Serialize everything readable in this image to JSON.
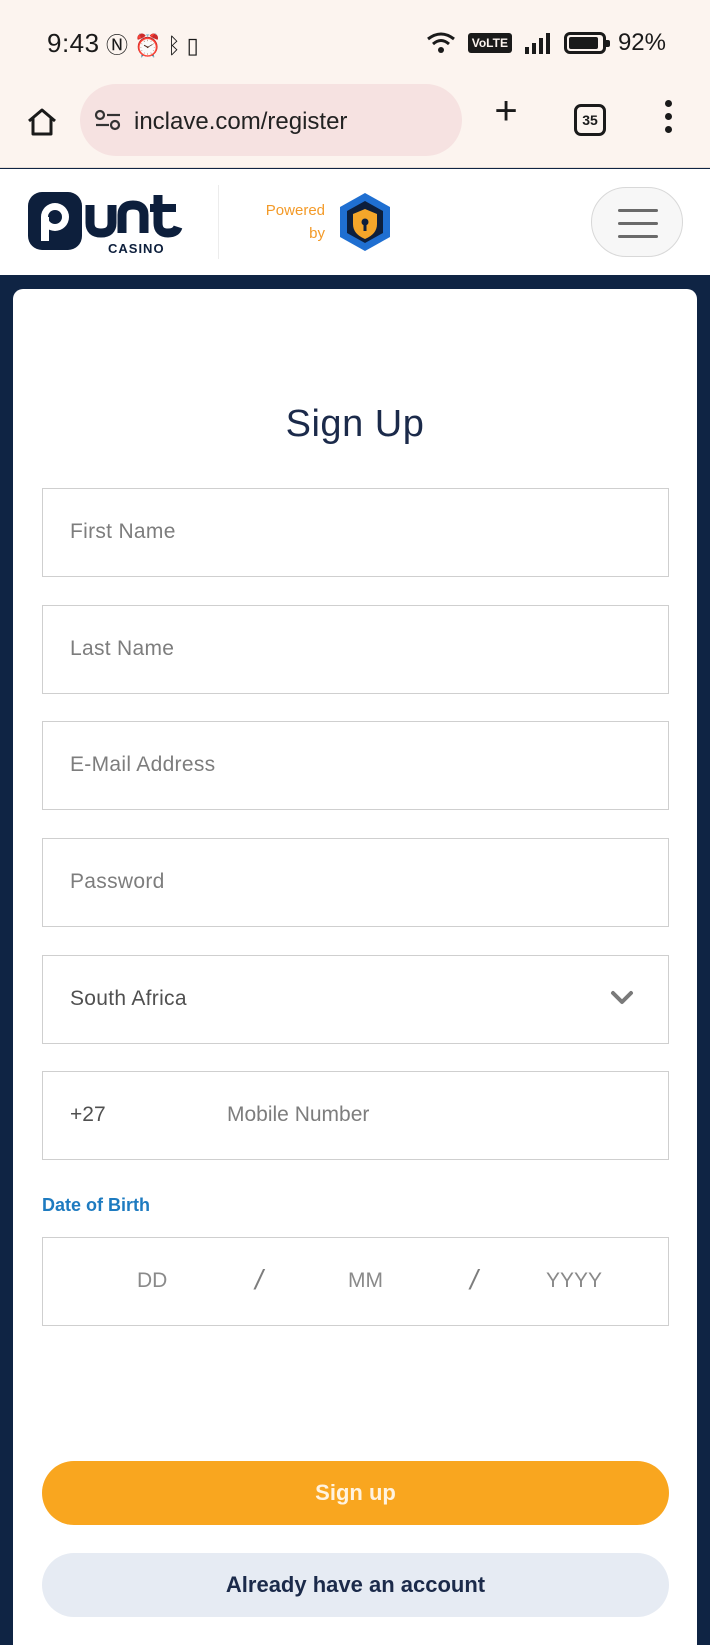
{
  "status_bar": {
    "time": "9:43",
    "icons_left": [
      "nfc-icon",
      "alarm-icon",
      "bluetooth-icon",
      "vibrate-icon"
    ],
    "volte": "VoLTE",
    "battery": "92%",
    "battery_level": 0.92
  },
  "browser": {
    "url": "inclave.com/register",
    "tab_count": "35"
  },
  "header": {
    "logo_text": "Punt",
    "logo_sub": "CASINO",
    "powered_line1": "Powered",
    "powered_line2": "by"
  },
  "form": {
    "title": "Sign Up",
    "first_name_placeholder": "First Name",
    "last_name_placeholder": "Last Name",
    "email_placeholder": "E-Mail Address",
    "password_placeholder": "Password",
    "country_value": "South Africa",
    "phone_prefix": "+27",
    "mobile_placeholder": "Mobile Number",
    "dob_label": "Date of Birth",
    "dob_day": "DD",
    "dob_month": "MM",
    "dob_year": "YYYY",
    "dob_separator": "/",
    "signup_label": "Sign up",
    "login_label": "Already have an account"
  },
  "colors": {
    "page_bg": "#0f2444",
    "accent": "#f9a61f",
    "link_blue": "#1e7bc0",
    "title": "#1b2a4a"
  }
}
